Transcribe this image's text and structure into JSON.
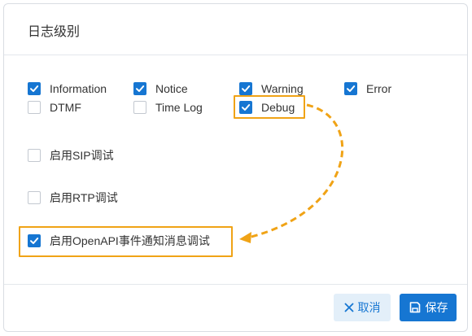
{
  "dialog": {
    "title": "日志级别"
  },
  "log_levels": [
    {
      "label": "Information",
      "checked": true
    },
    {
      "label": "Notice",
      "checked": true
    },
    {
      "label": "Warning",
      "checked": true
    },
    {
      "label": "Error",
      "checked": true
    },
    {
      "label": "DTMF",
      "checked": false
    },
    {
      "label": "Time Log",
      "checked": false
    },
    {
      "label": "Debug",
      "checked": true
    }
  ],
  "options": [
    {
      "label": "启用SIP调试",
      "checked": false
    },
    {
      "label": "启用RTP调试",
      "checked": false
    },
    {
      "label": "启用OpenAPI事件通知消息调试",
      "checked": true
    }
  ],
  "footer": {
    "cancel_label": "取消",
    "save_label": "保存",
    "cancel_icon": "close-icon",
    "save_icon": "save-icon"
  },
  "colors": {
    "accent": "#1676d2",
    "highlight": "#f0a316"
  }
}
